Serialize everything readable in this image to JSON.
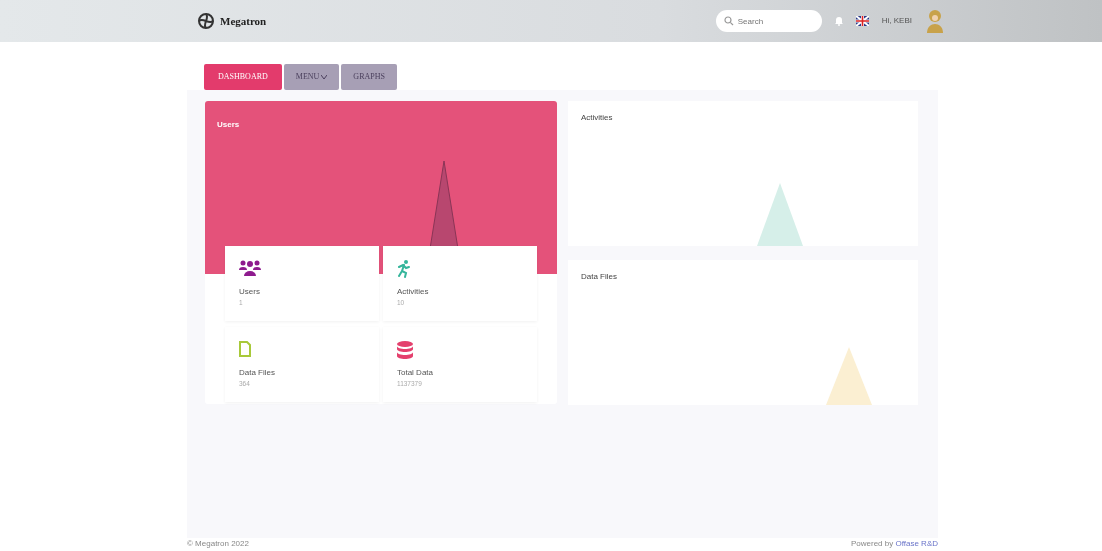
{
  "brand": {
    "name": "Megatron"
  },
  "search": {
    "placeholder": "Search"
  },
  "user": {
    "greeting": "Hi, KEBI"
  },
  "tabs": [
    {
      "label": "DASHBOARD",
      "selected": true,
      "dropdown": false
    },
    {
      "label": "MENU",
      "selected": false,
      "dropdown": true
    },
    {
      "label": "GRAPHS",
      "selected": false,
      "dropdown": false
    }
  ],
  "users_panel": {
    "title": "Users"
  },
  "stats": [
    {
      "kind": "users",
      "label": "Users",
      "value": "1",
      "color": "#8e1b8e"
    },
    {
      "kind": "activity",
      "label": "Activities",
      "value": "10",
      "color": "#35b59b"
    },
    {
      "kind": "file",
      "label": "Data Files",
      "value": "364",
      "color": "#a8c93a"
    },
    {
      "kind": "database",
      "label": "Total Data",
      "value": "1137379",
      "color": "#e4406d"
    }
  ],
  "panels": [
    {
      "title": "Activities",
      "color": "#d6efe9"
    },
    {
      "title": "Data Files",
      "color": "#fbefd2"
    }
  ],
  "footer": {
    "copyright": "© Megatron 2022",
    "powered": "Powered by",
    "link": "Offase R&D"
  }
}
